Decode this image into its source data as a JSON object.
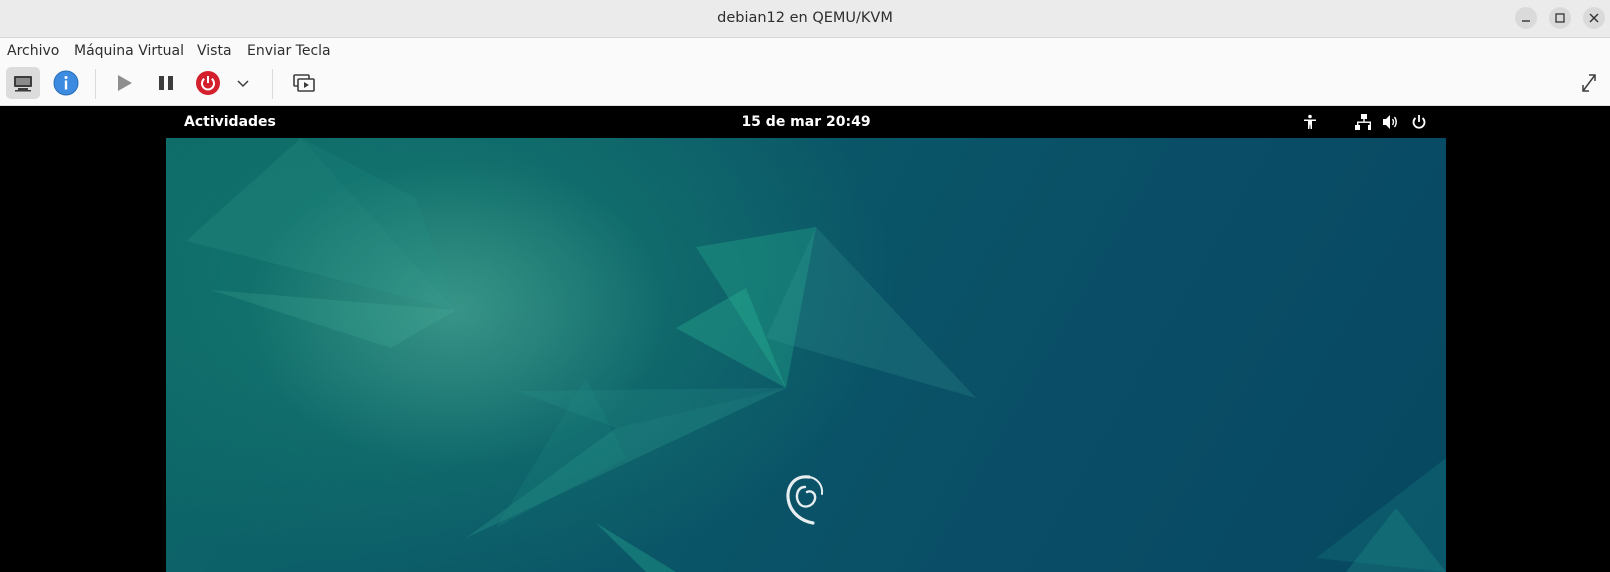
{
  "window": {
    "title": "debian12 en QEMU/KVM",
    "controls": [
      "minimize-icon",
      "maximize-icon",
      "close-icon"
    ]
  },
  "menubar": {
    "items": [
      "Archivo",
      "Máquina Virtual",
      "Vista",
      "Enviar Tecla"
    ]
  },
  "toolbar": {
    "buttons": [
      {
        "icon": "monitor-icon",
        "active": true
      },
      {
        "icon": "info-icon"
      },
      {
        "icon": "play-icon"
      },
      {
        "icon": "pause-icon"
      },
      {
        "icon": "power-icon"
      },
      {
        "icon": "chevron-down-icon"
      },
      {
        "icon": "snapshots-icon"
      },
      {
        "icon": "fullscreen-icon"
      }
    ]
  },
  "guest": {
    "topbar": {
      "activities": "Actividades",
      "clock": "15 de mar  20:49",
      "icons": [
        "accessibility-icon",
        "network-icon",
        "volume-icon",
        "power-menu-icon"
      ]
    },
    "desktop": {
      "logo": "debian-swirl-icon",
      "colors": {
        "accent": "#0b5a68",
        "highlight": "#1fa58b"
      }
    }
  },
  "colors": {
    "titlebar": "#ebebeb",
    "toolbar": "#fafafa",
    "power": "#d41f2c",
    "info": "#3d8be0"
  }
}
